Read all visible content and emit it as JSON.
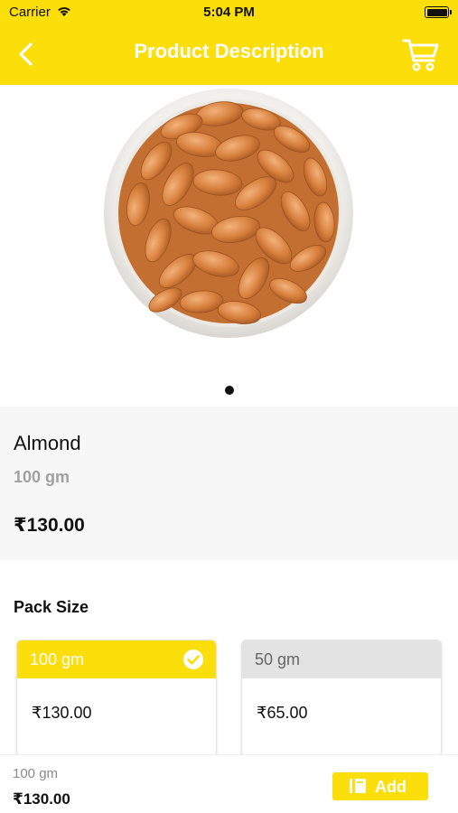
{
  "status_bar": {
    "carrier": "Carrier",
    "time": "5:04 PM"
  },
  "header": {
    "title": "Product Description",
    "back_icon": "chevron-left-icon",
    "cart_icon": "cart-icon",
    "background": "#fcde0a"
  },
  "product": {
    "name": "Almond",
    "quantity": "100 gm",
    "price": "₹130.00",
    "image": "almond-bowl-image",
    "carousel": {
      "current_page": 1,
      "page_count": 1
    }
  },
  "pack_size": {
    "heading": "Pack Size",
    "options": [
      {
        "size": "100 gm",
        "price": "₹130.00",
        "selected": true
      },
      {
        "size": "50 gm",
        "price": "₹65.00",
        "selected": false
      }
    ]
  },
  "bottom_bar": {
    "quantity": "100 gm",
    "price": "₹130.00",
    "add_label": "Add",
    "add_icon": "bag-icon"
  }
}
